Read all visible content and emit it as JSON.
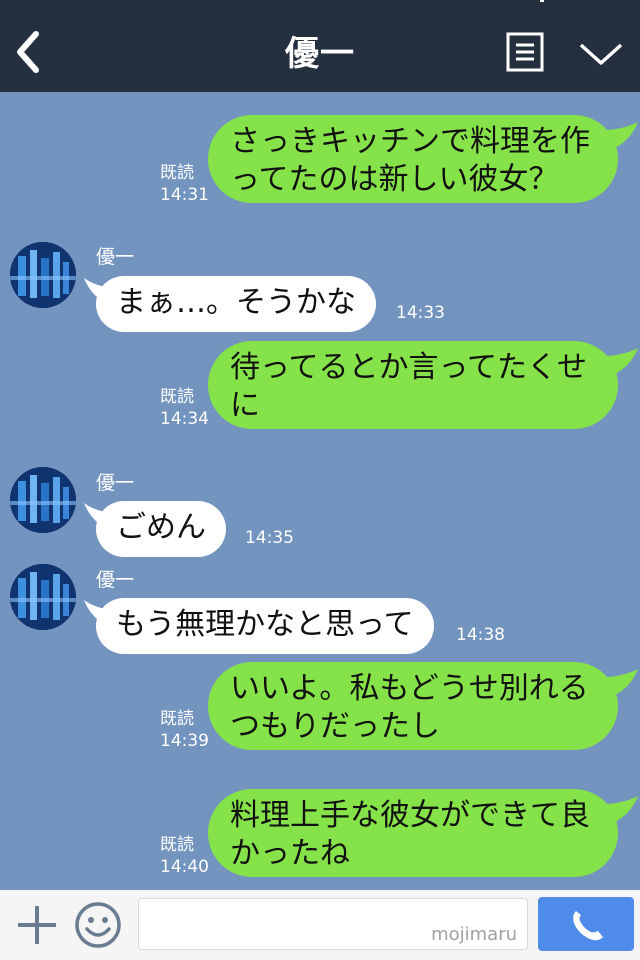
{
  "header": {
    "title": "優一"
  },
  "messages": [
    {
      "side": "me",
      "lines": [
        "さっきキッチンで料理を作",
        "ってたのは新しい彼女？"
      ],
      "read": "既読",
      "time": "14:31"
    },
    {
      "side": "them",
      "sender": "優一",
      "text": "まぁ…。そうかな",
      "time": "14:33"
    },
    {
      "side": "me",
      "lines": [
        "待ってるとか言ってたくせ",
        "に"
      ],
      "read": "既読",
      "time": "14:34"
    },
    {
      "side": "them",
      "sender": "優一",
      "text": "ごめん",
      "time": "14:35"
    },
    {
      "side": "them",
      "sender": "優一",
      "text": "もう無理かなと思って",
      "time": "14:38"
    },
    {
      "side": "me",
      "lines": [
        "いいよ。私もどうせ別れる",
        "つもりだったし"
      ],
      "read": "既読",
      "time": "14:39"
    },
    {
      "side": "me",
      "lines": [
        "料理上手な彼女ができて良",
        "かったね"
      ],
      "read": "既読",
      "time": "14:40"
    }
  ],
  "input": {
    "watermark": "mojimaru"
  },
  "icons": [
    "back-icon",
    "menu-icon",
    "chevron-down-icon",
    "plus-icon",
    "smiley-icon",
    "phone-icon"
  ],
  "colors": {
    "header": "#243040",
    "background": "#7494c0",
    "my_bubble": "#86e249",
    "their_bubble": "#ffffff",
    "call_button": "#4f8be8"
  }
}
